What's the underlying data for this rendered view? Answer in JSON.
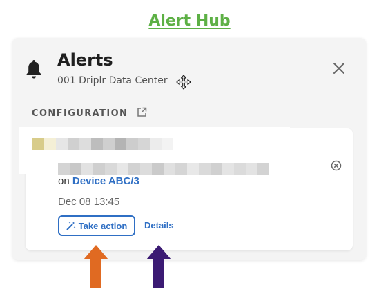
{
  "header": {
    "title": "Alert Hub"
  },
  "panel": {
    "title": "Alerts",
    "subtitle": "001 Driplr Data Center",
    "icons": {
      "bell": "bell-icon",
      "close": "close-icon",
      "move_cursor": "move-cursor-icon"
    }
  },
  "configuration": {
    "label": "CONFIGURATION",
    "icon": "external-link-icon"
  },
  "alert": {
    "device_prefix": "on",
    "device_name": "Device ABC/3",
    "timestamp": "Dec 08 13:45",
    "take_action_label": "Take action",
    "take_action_icon": "magic-wand-icon",
    "details_label": "Details",
    "dismiss_icon": "close-circle-icon"
  },
  "arrows": [
    {
      "name": "orange-arrow",
      "color": "#e06a22"
    },
    {
      "name": "purple-arrow",
      "color": "#3b1a73"
    }
  ],
  "colors": {
    "accent": "#2f6fc4",
    "title_green": "#5db045"
  }
}
